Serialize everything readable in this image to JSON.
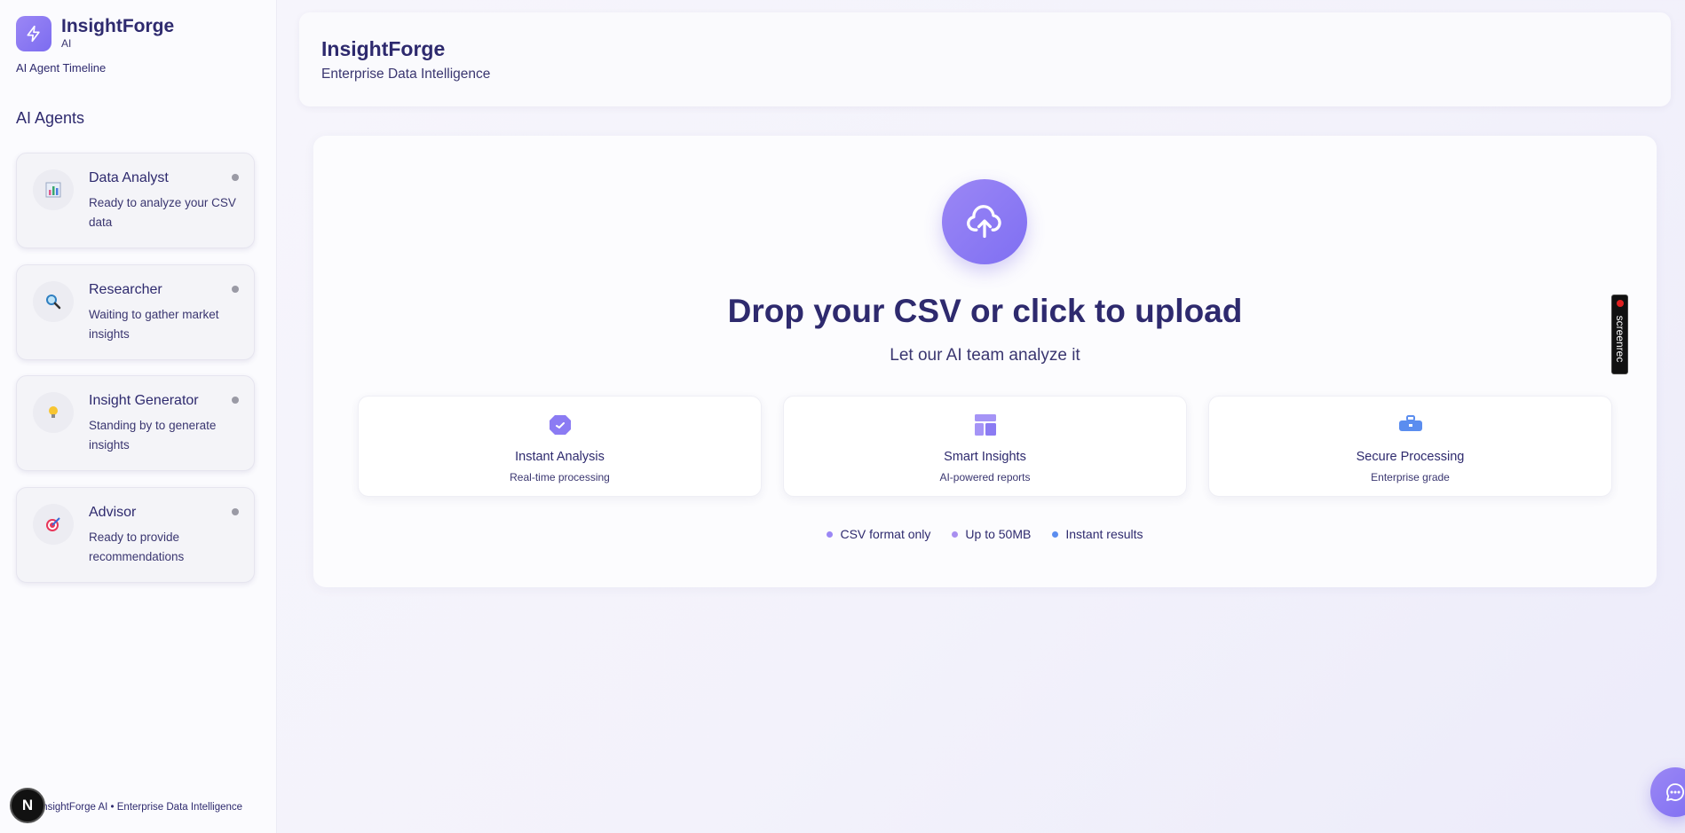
{
  "sidebar": {
    "brand_name": "InsightForge",
    "brand_sub": "AI",
    "timeline_label": "AI Agent Timeline",
    "agents_heading": "AI Agents",
    "agents": [
      {
        "name": "Data Analyst",
        "desc": "Ready to analyze your CSV data",
        "icon": "chart-icon"
      },
      {
        "name": "Researcher",
        "desc": "Waiting to gather market insights",
        "icon": "magnifier-icon"
      },
      {
        "name": "Insight Generator",
        "desc": "Standing by to generate insights",
        "icon": "lightbulb-icon"
      },
      {
        "name": "Advisor",
        "desc": "Ready to provide recommendations",
        "icon": "target-icon"
      }
    ],
    "footer": "InsightForge AI • Enterprise Data Intelligence",
    "badge_letter": "N"
  },
  "header": {
    "title": "InsightForge",
    "subtitle": "Enterprise Data Intelligence"
  },
  "upload": {
    "title": "Drop your CSV or click to upload",
    "subtitle": "Let our AI team analyze it",
    "features": [
      {
        "title": "Instant Analysis",
        "sub": "Real-time processing",
        "icon": "gauge-icon"
      },
      {
        "title": "Smart Insights",
        "sub": "AI-powered reports",
        "icon": "layout-icon"
      },
      {
        "title": "Secure Processing",
        "sub": "Enterprise grade",
        "icon": "briefcase-icon"
      }
    ],
    "chips": [
      {
        "label": "CSV format only",
        "color": "#9b87f5"
      },
      {
        "label": "Up to 50MB",
        "color": "#a98ff0"
      },
      {
        "label": "Instant results",
        "color": "#5b8def"
      }
    ]
  },
  "screenrec_label": "screenrec",
  "colors": {
    "accent": "#8b7bf3",
    "text": "#2e2a6e"
  }
}
